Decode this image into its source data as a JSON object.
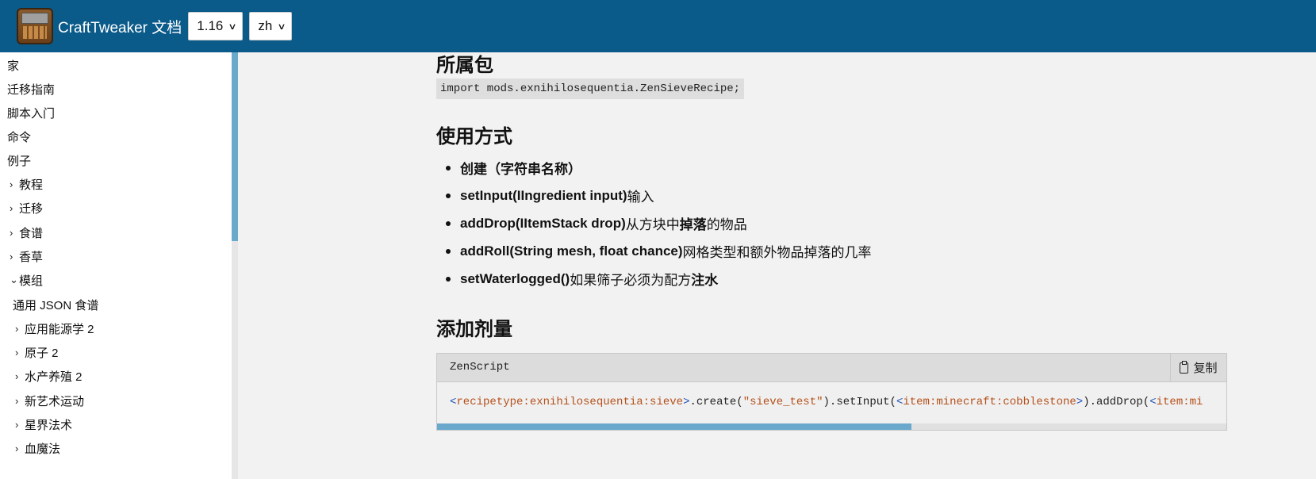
{
  "header": {
    "site_title": "CraftTweaker 文档",
    "version_select": "1.16",
    "language_select": "zh"
  },
  "sidebar": {
    "items": [
      {
        "label": "家",
        "caret": ""
      },
      {
        "label": "迁移指南",
        "caret": ""
      },
      {
        "label": "脚本入门",
        "caret": ""
      },
      {
        "label": "命令",
        "caret": ""
      },
      {
        "label": "例子",
        "caret": ""
      },
      {
        "label": "教程",
        "caret": "›"
      },
      {
        "label": "迁移",
        "caret": "›"
      },
      {
        "label": "食谱",
        "caret": "›"
      },
      {
        "label": "香草",
        "caret": "›"
      },
      {
        "label": "模组",
        "caret": "⌄"
      },
      {
        "label": "通用 JSON 食谱",
        "caret": ""
      },
      {
        "label": "应用能源学 2",
        "caret": "›"
      },
      {
        "label": "原子 2",
        "caret": "›"
      },
      {
        "label": "水产养殖 2",
        "caret": "›"
      },
      {
        "label": "新艺术运动",
        "caret": "›"
      },
      {
        "label": "星界法术",
        "caret": "›"
      },
      {
        "label": "血魔法",
        "caret": "›"
      }
    ]
  },
  "main": {
    "package_heading": "所属包",
    "import_code": "import mods.exnihilosequentia.ZenSieveRecipe;",
    "usage_heading": "使用方式",
    "usage_items": [
      {
        "bold": "创建（字符串名称）",
        "text": "",
        "bold2": "",
        "text2": ""
      },
      {
        "bold": "setInput(IIngredient input)",
        "text": "输入",
        "bold2": "",
        "text2": ""
      },
      {
        "bold": "addDrop(IItemStack drop)",
        "text": "从方块中",
        "bold2": "掉落",
        "text2": "的物品"
      },
      {
        "bold": "addRoll(String mesh, float chance)",
        "text": "网格类型和额外物品掉落的几率",
        "bold2": "",
        "text2": ""
      },
      {
        "bold": "setWaterlogged()",
        "text": "如果筛子必须为配方",
        "bold2": "注水",
        "text2": ""
      }
    ],
    "add_heading": "添加剂量",
    "code": {
      "language": "ZenScript",
      "copy_label": "复制",
      "tokens": {
        "t1": "<",
        "t2": "recipetype:exnihilosequentia:sieve",
        "t3": ">",
        "t4": ".create(",
        "t5": "\"sieve_test\"",
        "t6": ").setInput(",
        "t7": "<",
        "t8": "item:minecraft:cobblestone",
        "t9": ">",
        "t10": ").addDrop(",
        "t11": "<",
        "t12": "item:mi"
      }
    }
  },
  "colors": {
    "header_bg": "#0a5a8a",
    "scroll_thumb": "#6aa9cc",
    "code_bracket": "#1a4fb5",
    "code_type": "#b5501a"
  }
}
